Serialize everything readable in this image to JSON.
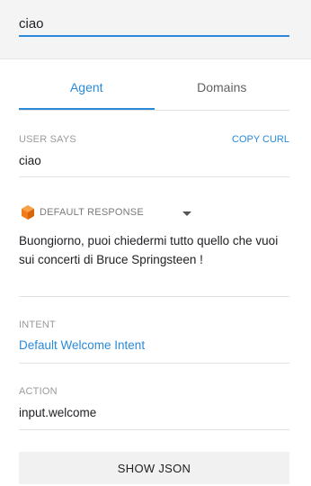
{
  "query": {
    "value": "ciao"
  },
  "tabs": [
    {
      "label": "Agent",
      "active": true
    },
    {
      "label": "Domains",
      "active": false
    }
  ],
  "user_says": {
    "label": "USER SAYS",
    "value": "ciao",
    "copy_label": "COPY CURL"
  },
  "response": {
    "icon": "cube-icon",
    "label": "DEFAULT RESPONSE",
    "text": "Buongiorno, puoi chiedermi tutto quello che vuoi sui concerti di Bruce Springsteen !"
  },
  "intent": {
    "label": "INTENT",
    "value": "Default Welcome Intent"
  },
  "action": {
    "label": "ACTION",
    "value": "input.welcome"
  },
  "show_json_label": "SHOW JSON",
  "colors": {
    "accent": "#2a8ad8",
    "icon_orange": "#f07c1a"
  }
}
